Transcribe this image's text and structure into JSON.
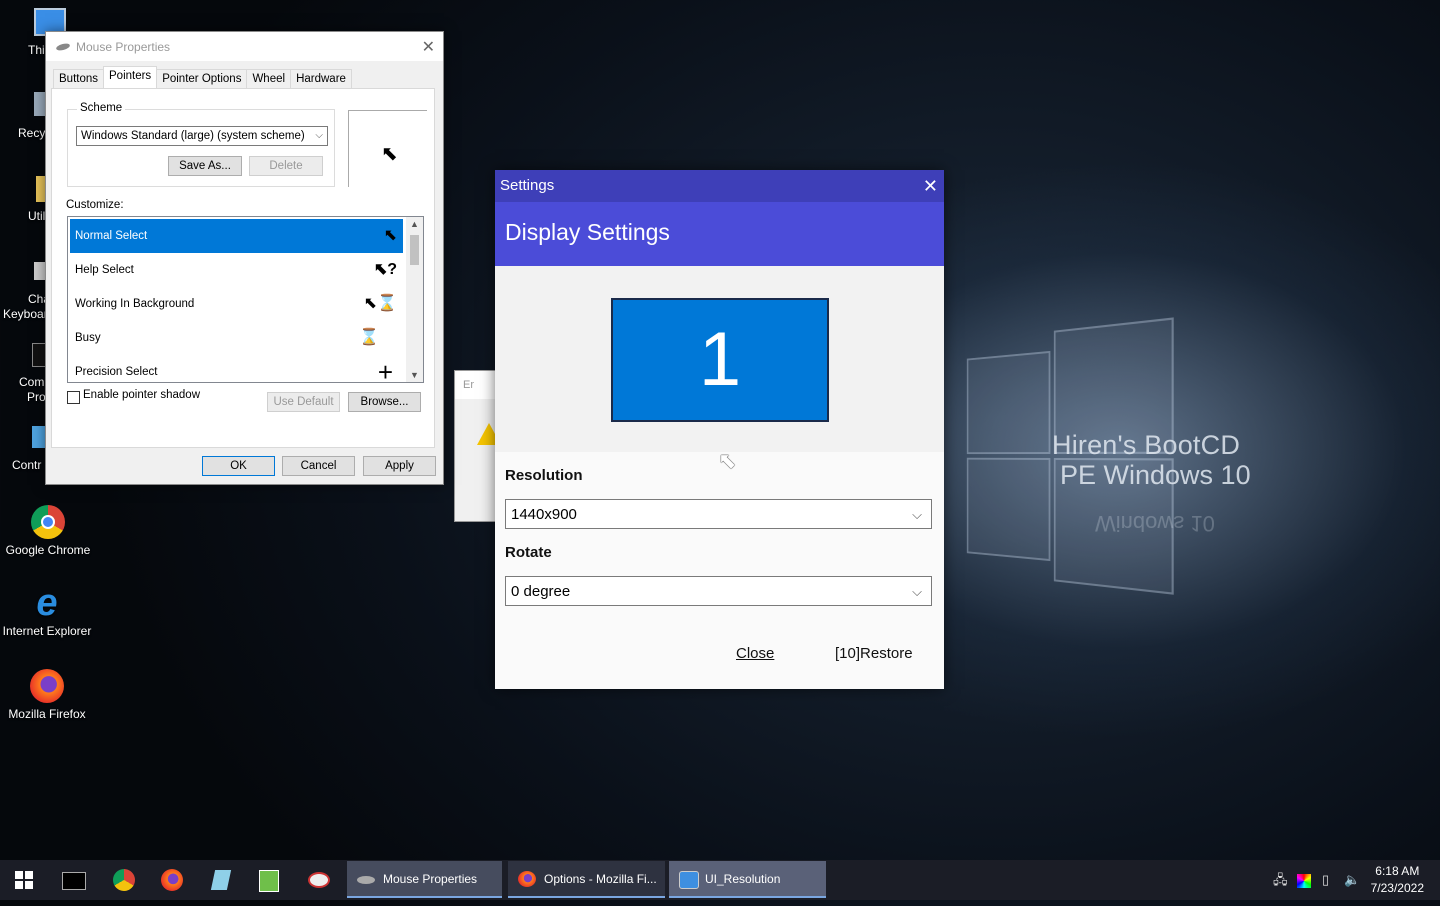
{
  "wallpaper": {
    "line1": "Hiren's BootCD",
    "line2": "PE Windows 10",
    "reflection": "Windows 10"
  },
  "desktop": {
    "partial_labels": [
      "Thi",
      "Recy",
      "Util",
      "Cha",
      "Keyboar",
      "Com",
      "Pro",
      "Contr"
    ],
    "icons": [
      {
        "label": "Google Chrome",
        "icon": "chrome-icon"
      },
      {
        "label": "Internet Explorer",
        "icon": "ie-icon"
      },
      {
        "label": "Mozilla Firefox",
        "icon": "firefox-icon"
      }
    ]
  },
  "mouse_properties": {
    "title": "Mouse Properties",
    "tabs": [
      "Buttons",
      "Pointers",
      "Pointer Options",
      "Wheel",
      "Hardware"
    ],
    "active_tab": "Pointers",
    "scheme_label": "Scheme",
    "scheme_value": "Windows Standard (large) (system scheme)",
    "save_as": "Save As...",
    "delete": "Delete",
    "customize_label": "Customize:",
    "items": [
      {
        "label": "Normal Select",
        "glyph": "➤"
      },
      {
        "label": "Help Select",
        "glyph": "?"
      },
      {
        "label": "Working In Background",
        "glyph": "⌛"
      },
      {
        "label": "Busy",
        "glyph": "⌛"
      },
      {
        "label": "Precision Select",
        "glyph": "+"
      }
    ],
    "enable_shadow": "Enable pointer shadow",
    "use_default": "Use Default",
    "browse": "Browse...",
    "ok": "OK",
    "cancel": "Cancel",
    "apply": "Apply"
  },
  "error_dialog": {
    "title": "Er"
  },
  "settings": {
    "title": "Settings",
    "header": "Display Settings",
    "monitor_number": "1",
    "resolution_label": "Resolution",
    "resolution_value": "1440x900",
    "rotate_label": "Rotate",
    "rotate_value": "0 degree",
    "close": "Close",
    "restore_prefix": "[10]",
    "restore": "Restore"
  },
  "taskbar": {
    "tasks": [
      {
        "label": "Mouse Properties"
      },
      {
        "label": "Options - Mozilla Fi..."
      },
      {
        "label": "UI_Resolution"
      }
    ],
    "time": "6:18 AM",
    "date": "7/23/2022"
  }
}
